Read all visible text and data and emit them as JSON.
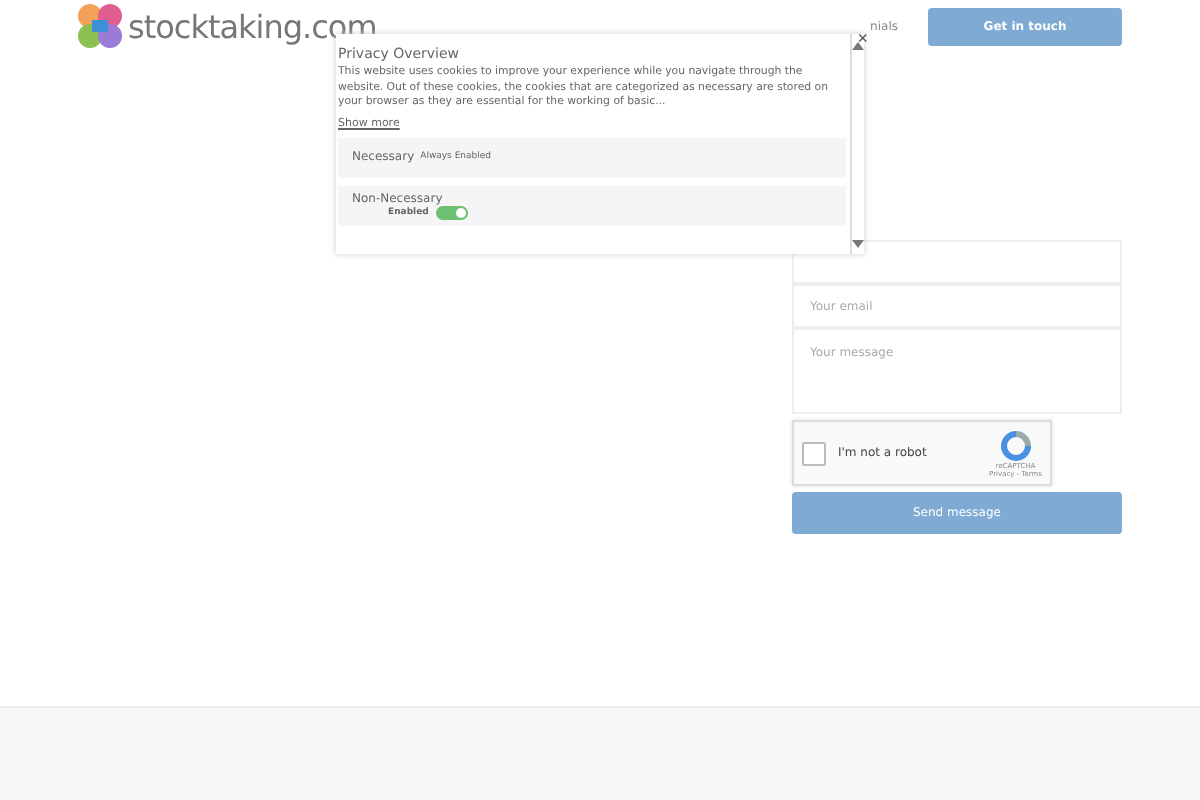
{
  "header": {
    "logo_text": "stocktaking.com",
    "nav_partial": "nials",
    "cta_button": "Get in touch"
  },
  "contact_form": {
    "fields": [
      {
        "placeholder": "Your email",
        "kind": "input"
      },
      {
        "placeholder": "Your message",
        "kind": "textarea"
      }
    ],
    "captcha": {
      "label": "I'm not a robot",
      "checked": false,
      "brand": "reCAPTCHA",
      "links": "Privacy - Terms"
    },
    "submit": "Send message"
  },
  "privacy_modal": {
    "title": "Privacy Overview",
    "body": "This website uses cookies to improve your experience while you navigate through the website. Out of these cookies, the cookies that are categorized as necessary are stored on your browser as they are essential for the working of basic...",
    "show_more": "Show more",
    "close": "×",
    "categories": [
      {
        "name": "Necessary",
        "status": "Always Enabled",
        "kind": "fixed"
      },
      {
        "name": "Non-Necessary",
        "status": "Enabled",
        "kind": "toggle",
        "on": true
      }
    ]
  }
}
